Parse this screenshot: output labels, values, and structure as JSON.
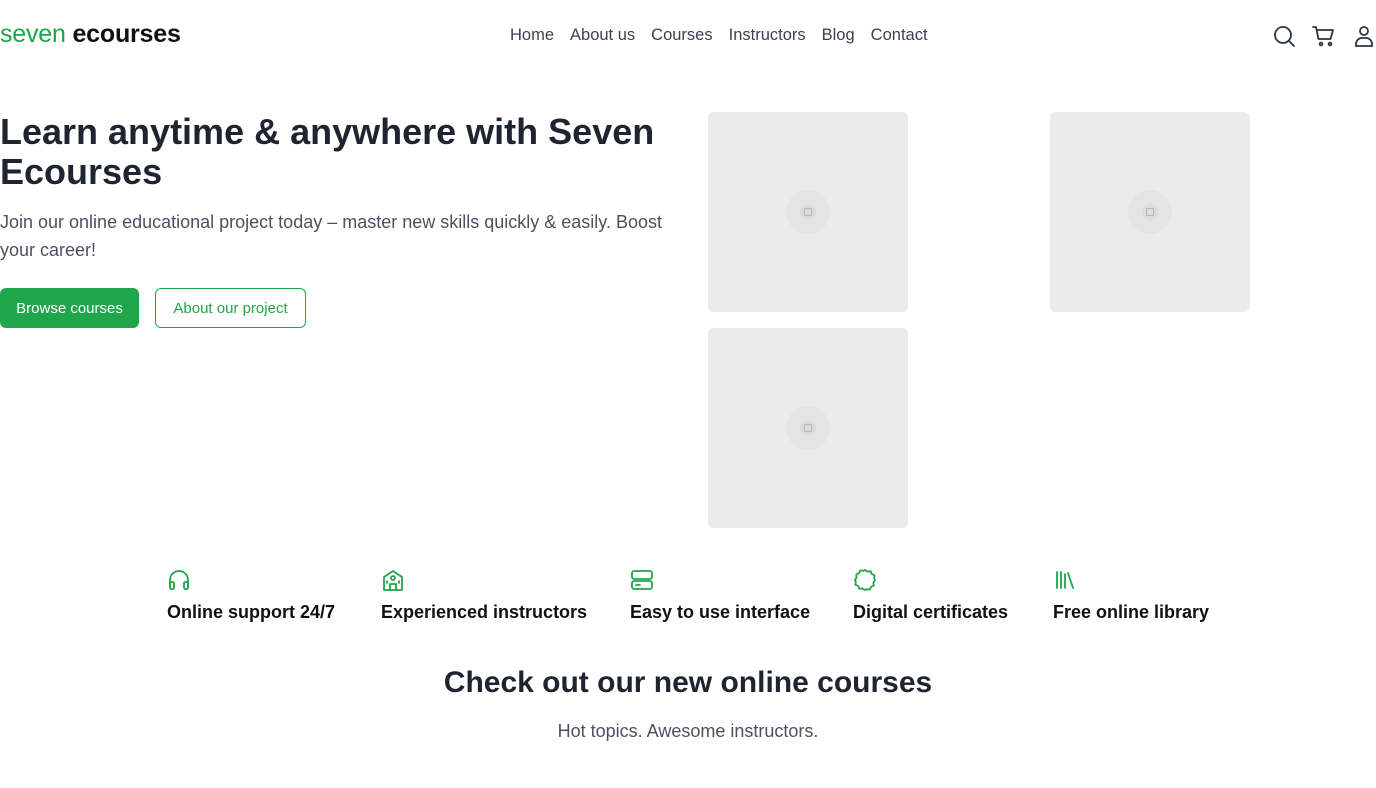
{
  "brand": {
    "part1": "seven",
    "part2": "ecourses",
    "accent_color": "#1fa64a"
  },
  "nav": {
    "items": [
      "Home",
      "About us",
      "Courses",
      "Instructors",
      "Blog",
      "Contact"
    ]
  },
  "header_icons": [
    "search-icon",
    "cart-icon",
    "user-icon"
  ],
  "hero": {
    "title": "Learn anytime & anywhere with Seven Ecourses",
    "subtitle": "Join our online educational project today – master new skills quickly & easily. Boost your career!",
    "primary_button": "Browse courses",
    "secondary_button": "About our project",
    "images": [
      "image-placeholder",
      "image-placeholder",
      "image-placeholder"
    ]
  },
  "features": [
    {
      "icon": "headphones-icon",
      "label": "Online support 24/7"
    },
    {
      "icon": "school-building-icon",
      "label": "Experienced instructors"
    },
    {
      "icon": "interface-icon",
      "label": "Easy to use interface"
    },
    {
      "icon": "certificate-icon",
      "label": "Digital certificates"
    },
    {
      "icon": "library-icon",
      "label": "Free online library"
    }
  ],
  "courses_section": {
    "title": "Check out our new online courses",
    "subtitle": "Hot topics. Awesome instructors."
  }
}
